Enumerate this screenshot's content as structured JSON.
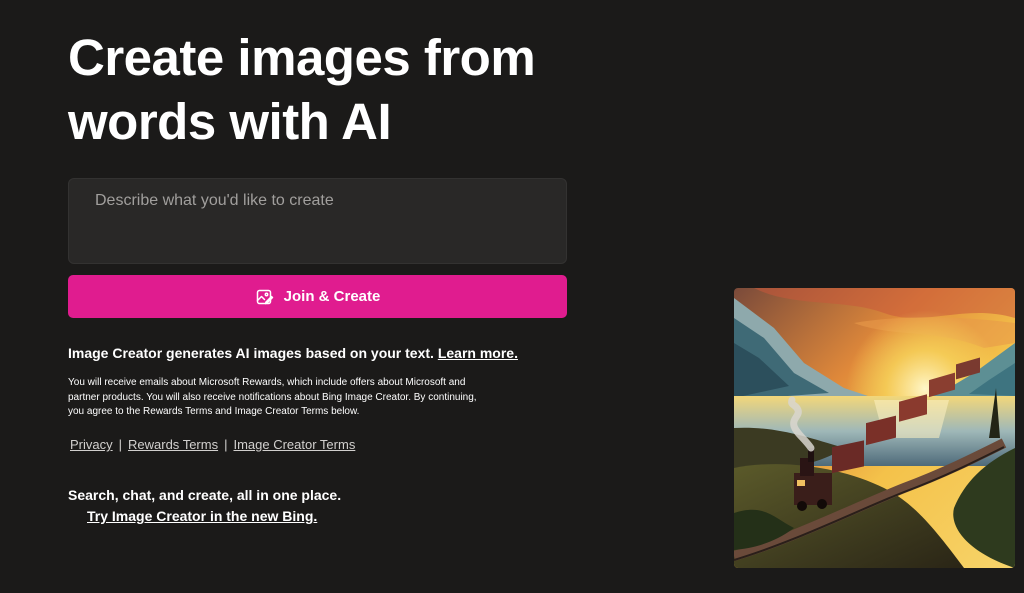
{
  "hero": {
    "title_line1": "Create images from",
    "title_line2": "words with AI"
  },
  "prompt": {
    "placeholder": "Describe what you'd like to create",
    "value": ""
  },
  "join_button": {
    "label": "Join & Create",
    "icon": "image-sparkle-icon",
    "color": "#e01c8f"
  },
  "info": {
    "text": "Image Creator generates AI images based on your text.",
    "learn_more": "Learn more."
  },
  "fine_print": "You will receive emails about Microsoft Rewards, which include offers about Microsoft and partner products. You will also receive notifications about Bing Image Creator. By continuing, you agree to the Rewards Terms and Image Creator Terms below.",
  "footer_links": {
    "privacy": "Privacy",
    "rewards_terms": "Rewards Terms",
    "image_creator_terms": "Image Creator Terms",
    "separator": "|"
  },
  "promo": {
    "text": "Search, chat, and create, all in one place.",
    "link": "Try Image Creator in the new Bing."
  },
  "showcase_image": {
    "subject": "painting of a steam train by a mountain lake at sunset"
  },
  "colors": {
    "background": "#1b1a19",
    "prompt_background": "#292827",
    "accent": "#e01c8f"
  }
}
